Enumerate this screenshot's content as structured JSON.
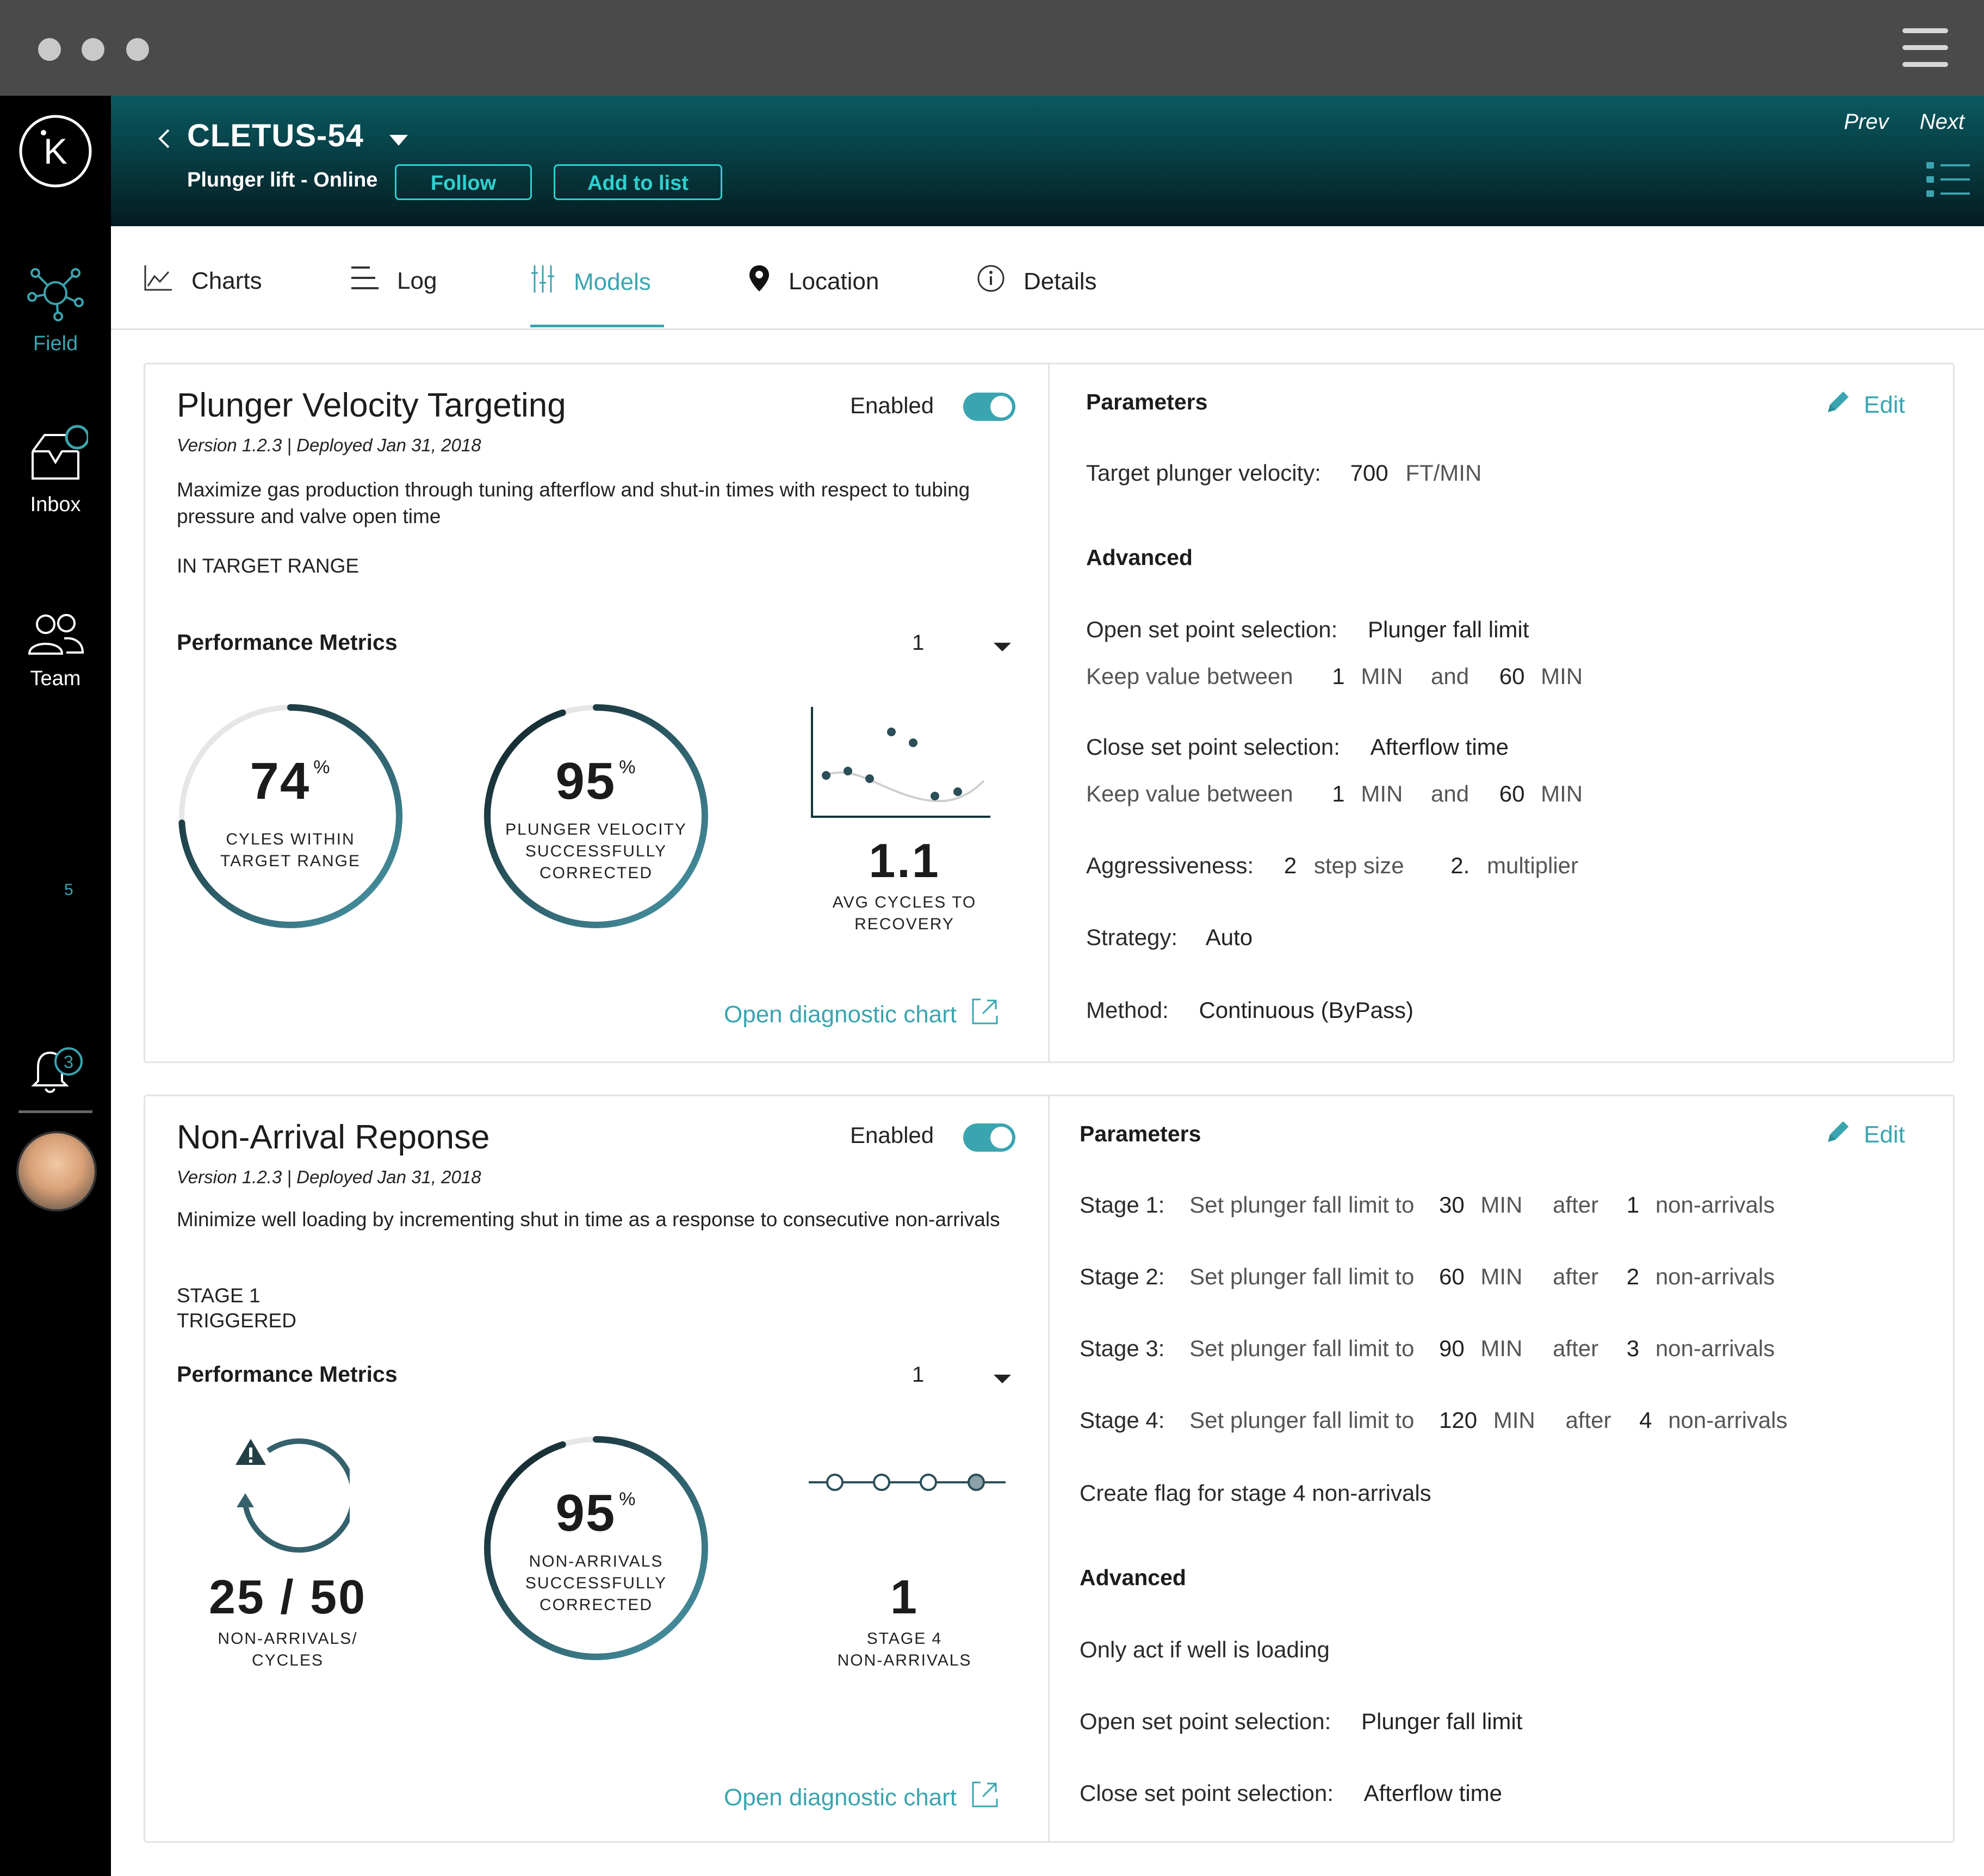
{
  "header": {
    "title": "CLETUS-54",
    "subtitle": "Plunger lift - Online",
    "follow_label": "Follow",
    "add_to_list_label": "Add to list",
    "prev_label": "Prev",
    "next_label": "Next"
  },
  "sidebar": {
    "logo": "K",
    "items": [
      {
        "label": "Field",
        "icon": "network-icon",
        "active": true
      },
      {
        "label": "Inbox",
        "icon": "inbox-icon"
      },
      {
        "label": "Team",
        "icon": "team-icon"
      }
    ],
    "count_small": "5",
    "notification_count": "3"
  },
  "tabs": [
    {
      "label": "Charts",
      "icon": "line-chart-icon"
    },
    {
      "label": "Log",
      "icon": "list-icon"
    },
    {
      "label": "Models",
      "icon": "sliders-icon",
      "active": true
    },
    {
      "label": "Location",
      "icon": "location-pin-icon"
    },
    {
      "label": "Details",
      "icon": "info-icon"
    }
  ],
  "colors": {
    "accent": "#3aa5b0",
    "dark": "#0d2b30",
    "header_top": "#0a5a60"
  },
  "models": [
    {
      "title": "Plunger Velocity Targeting",
      "version": "Version 1.2.3 | Deployed Jan 31, 2018",
      "description": "Maximize gas production through tuning afterflow and shut-in times with respect to tubing pressure and valve open time",
      "status": "IN TARGET RANGE",
      "enabled_label": "Enabled",
      "enabled": true,
      "perf_label": "Performance Metrics",
      "perf_select": "1",
      "metrics": [
        {
          "value": "74",
          "unit": "%",
          "caption1": "CYLES WITHIN",
          "caption2": "TARGET RANGE",
          "fill": 0.74
        },
        {
          "value": "95",
          "unit": "%",
          "caption1": "PLUNGER VELOCITY",
          "caption2": "SUCCESSFULLY",
          "caption3": "CORRECTED",
          "fill": 0.95
        },
        {
          "value": "1.1",
          "caption1": "AVG CYCLES TO",
          "caption2": "RECOVERY"
        }
      ],
      "diag_link": "Open diagnostic chart",
      "params_heading": "Parameters",
      "edit_label": "Edit",
      "target_label": "Target plunger velocity:",
      "target_value": "700",
      "target_unit": "FT/MIN",
      "advanced_label": "Advanced",
      "open_sel_label": "Open set point selection:",
      "open_sel_value": "Plunger fall limit",
      "keep_label": "Keep value between",
      "keep1_min": "1",
      "keep1_max": "60",
      "min_unit": "MIN",
      "and_label": "and",
      "close_sel_label": "Close set point selection:",
      "close_sel_value": "Afterflow time",
      "keep2_min": "1",
      "keep2_max": "60",
      "aggr_label": "Aggressiveness:",
      "aggr_step": "2",
      "aggr_step_label": "step size",
      "aggr_mult": "2.",
      "aggr_mult_label": "multiplier",
      "strategy_label": "Strategy:",
      "strategy_value": "Auto",
      "method_label": "Method:",
      "method_value": "Continuous (ByPass)"
    },
    {
      "title": "Non-Arrival Reponse",
      "version": "Version 1.2.3 | Deployed Jan 31, 2018",
      "description": "Minimize well loading by incrementing shut in time as a response to consecutive non-arrivals",
      "status1": "STAGE 1",
      "status2": "TRIGGERED",
      "enabled_label": "Enabled",
      "enabled": true,
      "perf_label": "Performance Metrics",
      "perf_select": "1",
      "metrics": [
        {
          "value": "25 / 50",
          "caption1": "NON-ARRIVALS/",
          "caption2": "CYCLES"
        },
        {
          "value": "95",
          "unit": "%",
          "caption1": "NON-ARRIVALS",
          "caption2": "SUCCESSFULLY",
          "caption3": "CORRECTED",
          "fill": 0.95
        },
        {
          "value": "1",
          "caption1": "STAGE 4",
          "caption2": "NON-ARRIVALS"
        }
      ],
      "diag_link": "Open diagnostic chart",
      "params_heading": "Parameters",
      "edit_label": "Edit",
      "stages": [
        {
          "label": "Stage 1:",
          "text": "Set plunger fall limit to",
          "value": "30",
          "unit": "MIN",
          "after": "after",
          "count": "1",
          "suffix": "non-arrivals"
        },
        {
          "label": "Stage 2:",
          "text": "Set plunger fall limit to",
          "value": "60",
          "unit": "MIN",
          "after": "after",
          "count": "2",
          "suffix": "non-arrivals"
        },
        {
          "label": "Stage 3:",
          "text": "Set plunger fall limit to",
          "value": "90",
          "unit": "MIN",
          "after": "after",
          "count": "3",
          "suffix": "non-arrivals"
        },
        {
          "label": "Stage 4:",
          "text": "Set plunger fall limit to",
          "value": "120",
          "unit": "MIN",
          "after": "after",
          "count": "4",
          "suffix": "non-arrivals"
        }
      ],
      "flag_text": "Create flag for stage 4 non-arrivals",
      "advanced_label": "Advanced",
      "only_act": "Only act if well is loading",
      "open_sel_label": "Open set point selection:",
      "open_sel_value": "Plunger fall limit",
      "close_sel_label": "Close set point selection:",
      "close_sel_value": "Afterflow time"
    }
  ]
}
